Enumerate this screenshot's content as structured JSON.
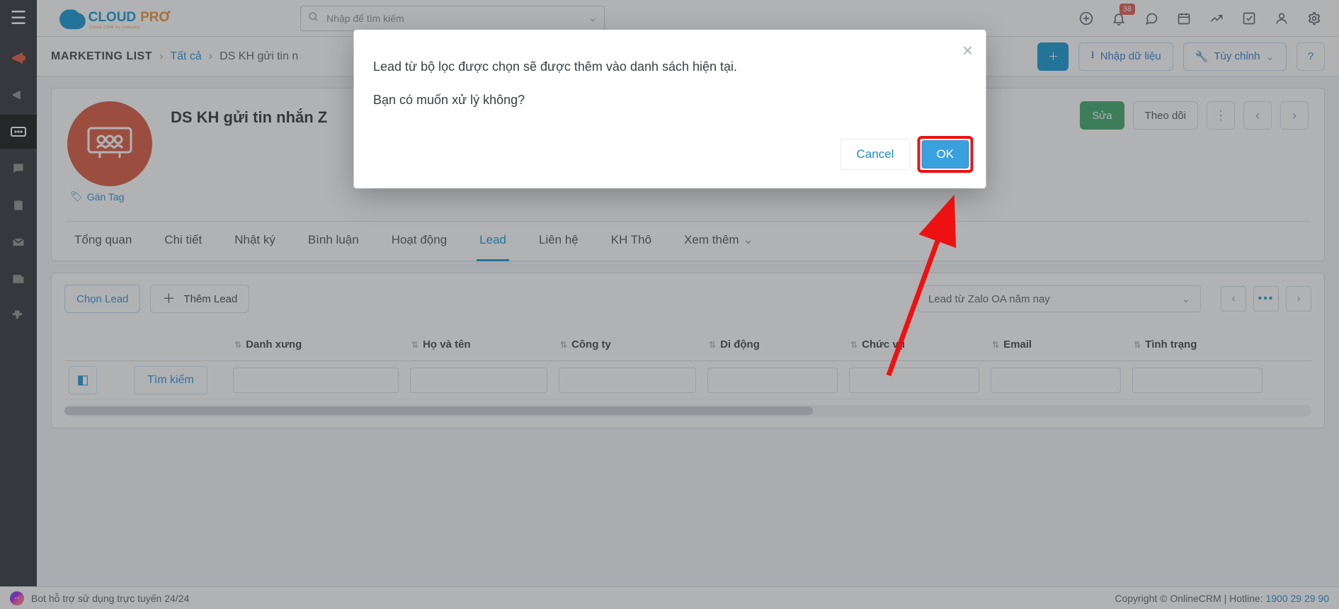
{
  "header": {
    "logo_main": "CLOUD",
    "logo_accent": "PRO",
    "logo_sub": "Cloud CRM by Industry",
    "search_placeholder": "Nhập để tìm kiếm",
    "badge_count": "38"
  },
  "breadcrumb": {
    "root": "MARKETING LIST",
    "level1": "Tất cả",
    "level2": "DS KH gửi tin n"
  },
  "subhead_buttons": {
    "import": "Nhập dữ liệu",
    "customize": "Tùy chỉnh"
  },
  "record": {
    "title": "DS KH gửi tin nhắn Z",
    "tag_link": "Gán Tag",
    "actions": {
      "edit": "Sửa",
      "follow": "Theo dõi"
    }
  },
  "tabs": [
    "Tổng quan",
    "Chi tiết",
    "Nhật ký",
    "Bình luận",
    "Hoạt động",
    "Lead",
    "Liên hệ",
    "KH Thô",
    "Xem thêm"
  ],
  "active_tab": "Lead",
  "lead_toolbar": {
    "select": "Chọn Lead",
    "add": "Thêm Lead",
    "filter": "Lead từ Zalo OA năm nay"
  },
  "columns": [
    "Danh xưng",
    "Họ và tên",
    "Công ty",
    "Di động",
    "Chức vụ",
    "Email",
    "Tình trạng"
  ],
  "search_button": "Tìm kiếm",
  "footer": {
    "bot": "Bot hỗ trợ sử dụng trực tuyến 24/24",
    "copyright": "Copyright © OnlineCRM | Hotline: ",
    "hotline": "1900 29 29 90"
  },
  "modal": {
    "line1": "Lead từ bộ lọc được chọn sẽ được thêm vào danh sách hiện tại.",
    "line2": "Bạn có muốn xử lý không?",
    "cancel": "Cancel",
    "ok": "OK"
  }
}
